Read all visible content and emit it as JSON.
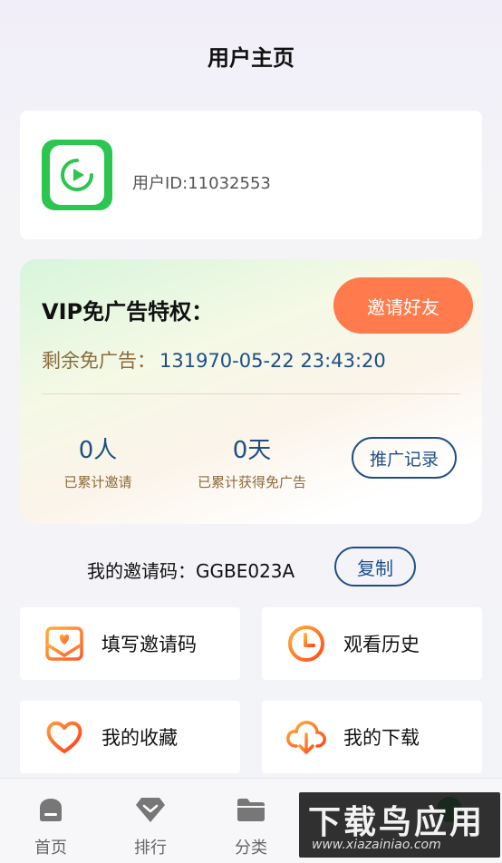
{
  "header": {
    "title": "用户主页"
  },
  "profile": {
    "user_id": "用户ID:11032553",
    "avatar_icon": "play-app-icon"
  },
  "vip": {
    "title": "VIP免广告特权：",
    "invite_button": "邀请好友",
    "remain_label": "剩余免广告：",
    "remain_value": "131970-05-22 23:43:20",
    "invited_count": "0人",
    "invited_label": "已累计邀请",
    "days_count": "0天",
    "days_label": "已累计获得免广告",
    "record_button": "推广记录"
  },
  "invite_code": {
    "label": "我的邀请码：",
    "code": "GGBE023A",
    "copy_button": "复制"
  },
  "menu": [
    {
      "label": "填写邀请码",
      "icon": "envelope-heart-icon"
    },
    {
      "label": "观看历史",
      "icon": "clock-icon"
    },
    {
      "label": "我的收藏",
      "icon": "heart-icon"
    },
    {
      "label": "我的下载",
      "icon": "cloud-download-icon"
    }
  ],
  "nav": [
    {
      "label": "首页",
      "icon": "home-icon"
    },
    {
      "label": "排行",
      "icon": "diamond-icon"
    },
    {
      "label": "分类",
      "icon": "folder-icon"
    },
    {
      "label": "",
      "icon": "user-icon"
    }
  ],
  "watermark": {
    "big": "下载鸟应用",
    "small": "www.xiazainiao.com"
  },
  "colors": {
    "accent_orange": "#ff7a4c",
    "link_blue": "#1d4f87",
    "brand_green": "#2bc64f"
  }
}
